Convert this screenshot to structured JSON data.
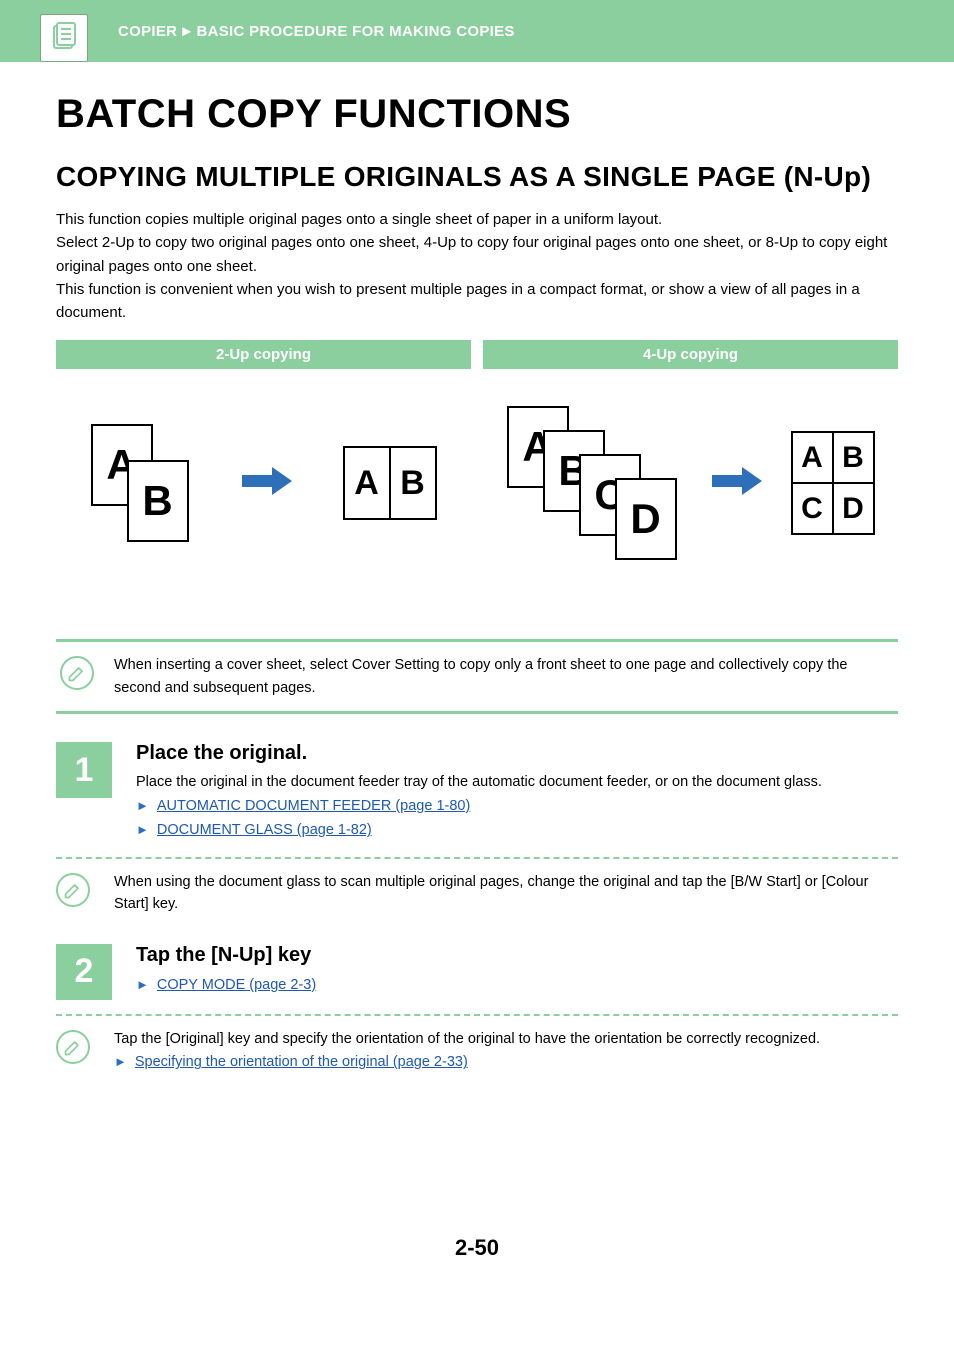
{
  "breadcrumb": {
    "part1": "COPIER",
    "arrow": "►",
    "part2": "BASIC PROCEDURE FOR MAKING COPIES"
  },
  "h1": "BATCH COPY FUNCTIONS",
  "h2": "COPYING MULTIPLE ORIGINALS AS A SINGLE PAGE (N-Up)",
  "intro": {
    "p1": "This function copies multiple original pages onto a single sheet of paper in a uniform layout.",
    "p2": "Select 2-Up to copy two original pages onto one sheet, 4-Up to copy four original pages onto one sheet, or 8-Up to copy eight original pages onto one sheet.",
    "p3": "This function is convenient when you wish to present multiple pages in a compact format, or show a view of all pages in a document."
  },
  "diagram": {
    "col2_title": "2-Up copying",
    "col4_title": "4-Up copying",
    "labels": {
      "A": "A",
      "B": "B",
      "C": "C",
      "D": "D"
    }
  },
  "note_cover": "When inserting a cover sheet, select Cover Setting to copy only a front sheet to one page and collectively copy the second and subsequent pages.",
  "step1": {
    "num": "1",
    "title": "Place the original.",
    "desc": "Place the original in the document feeder tray of the automatic document feeder, or on the document glass.",
    "link1": "AUTOMATIC DOCUMENT FEEDER (page 1-80)",
    "link2": "DOCUMENT GLASS (page 1-82)",
    "note": "When using the document glass to scan multiple original pages, change the original and tap the [B/W Start] or [Colour Start] key."
  },
  "step2": {
    "num": "2",
    "title": "Tap the [N-Up] key",
    "link1": "COPY MODE (page 2-3)",
    "note": "Tap the [Original] key and specify the orientation of the original to have the orientation be correctly recognized.",
    "link2": "Specifying the orientation of the original (page 2-33)"
  },
  "pagefoot": "2-50"
}
